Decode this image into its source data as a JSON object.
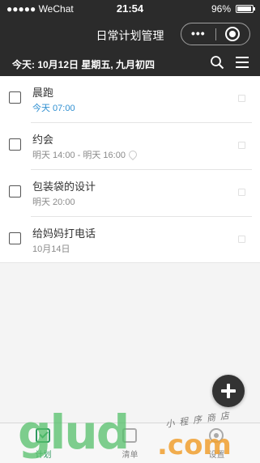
{
  "status_bar": {
    "carrier": "●●●●● WeChat",
    "time": "21:54",
    "battery_percent": "96%",
    "battery_level": 0.96
  },
  "nav": {
    "title": "日常计划管理",
    "more_label": "•••"
  },
  "date_bar": {
    "text": "今天: 10月12日 星期五, 九月初四"
  },
  "tasks": [
    {
      "title": "晨跑",
      "subtitle": "今天 07:00",
      "style": "today"
    },
    {
      "title": "约会",
      "subtitle": "明天 14:00 - 明天 16:00",
      "style": "normal",
      "has_location": true
    },
    {
      "title": "包装袋的设计",
      "subtitle": "明天 20:00",
      "style": "normal"
    },
    {
      "title": "给妈妈打电话",
      "subtitle": "10月14日",
      "style": "normal"
    }
  ],
  "tabs": [
    {
      "label": "计划",
      "active": true
    },
    {
      "label": "清单",
      "active": false
    },
    {
      "label": "设置",
      "active": false
    }
  ],
  "watermark": {
    "main": "glud",
    "com": ".com",
    "cn": "小程序商店"
  },
  "colors": {
    "header_bg": "#2b2b2b",
    "today_blue": "#2f8fd1",
    "active_green": "#2e9a5f"
  }
}
